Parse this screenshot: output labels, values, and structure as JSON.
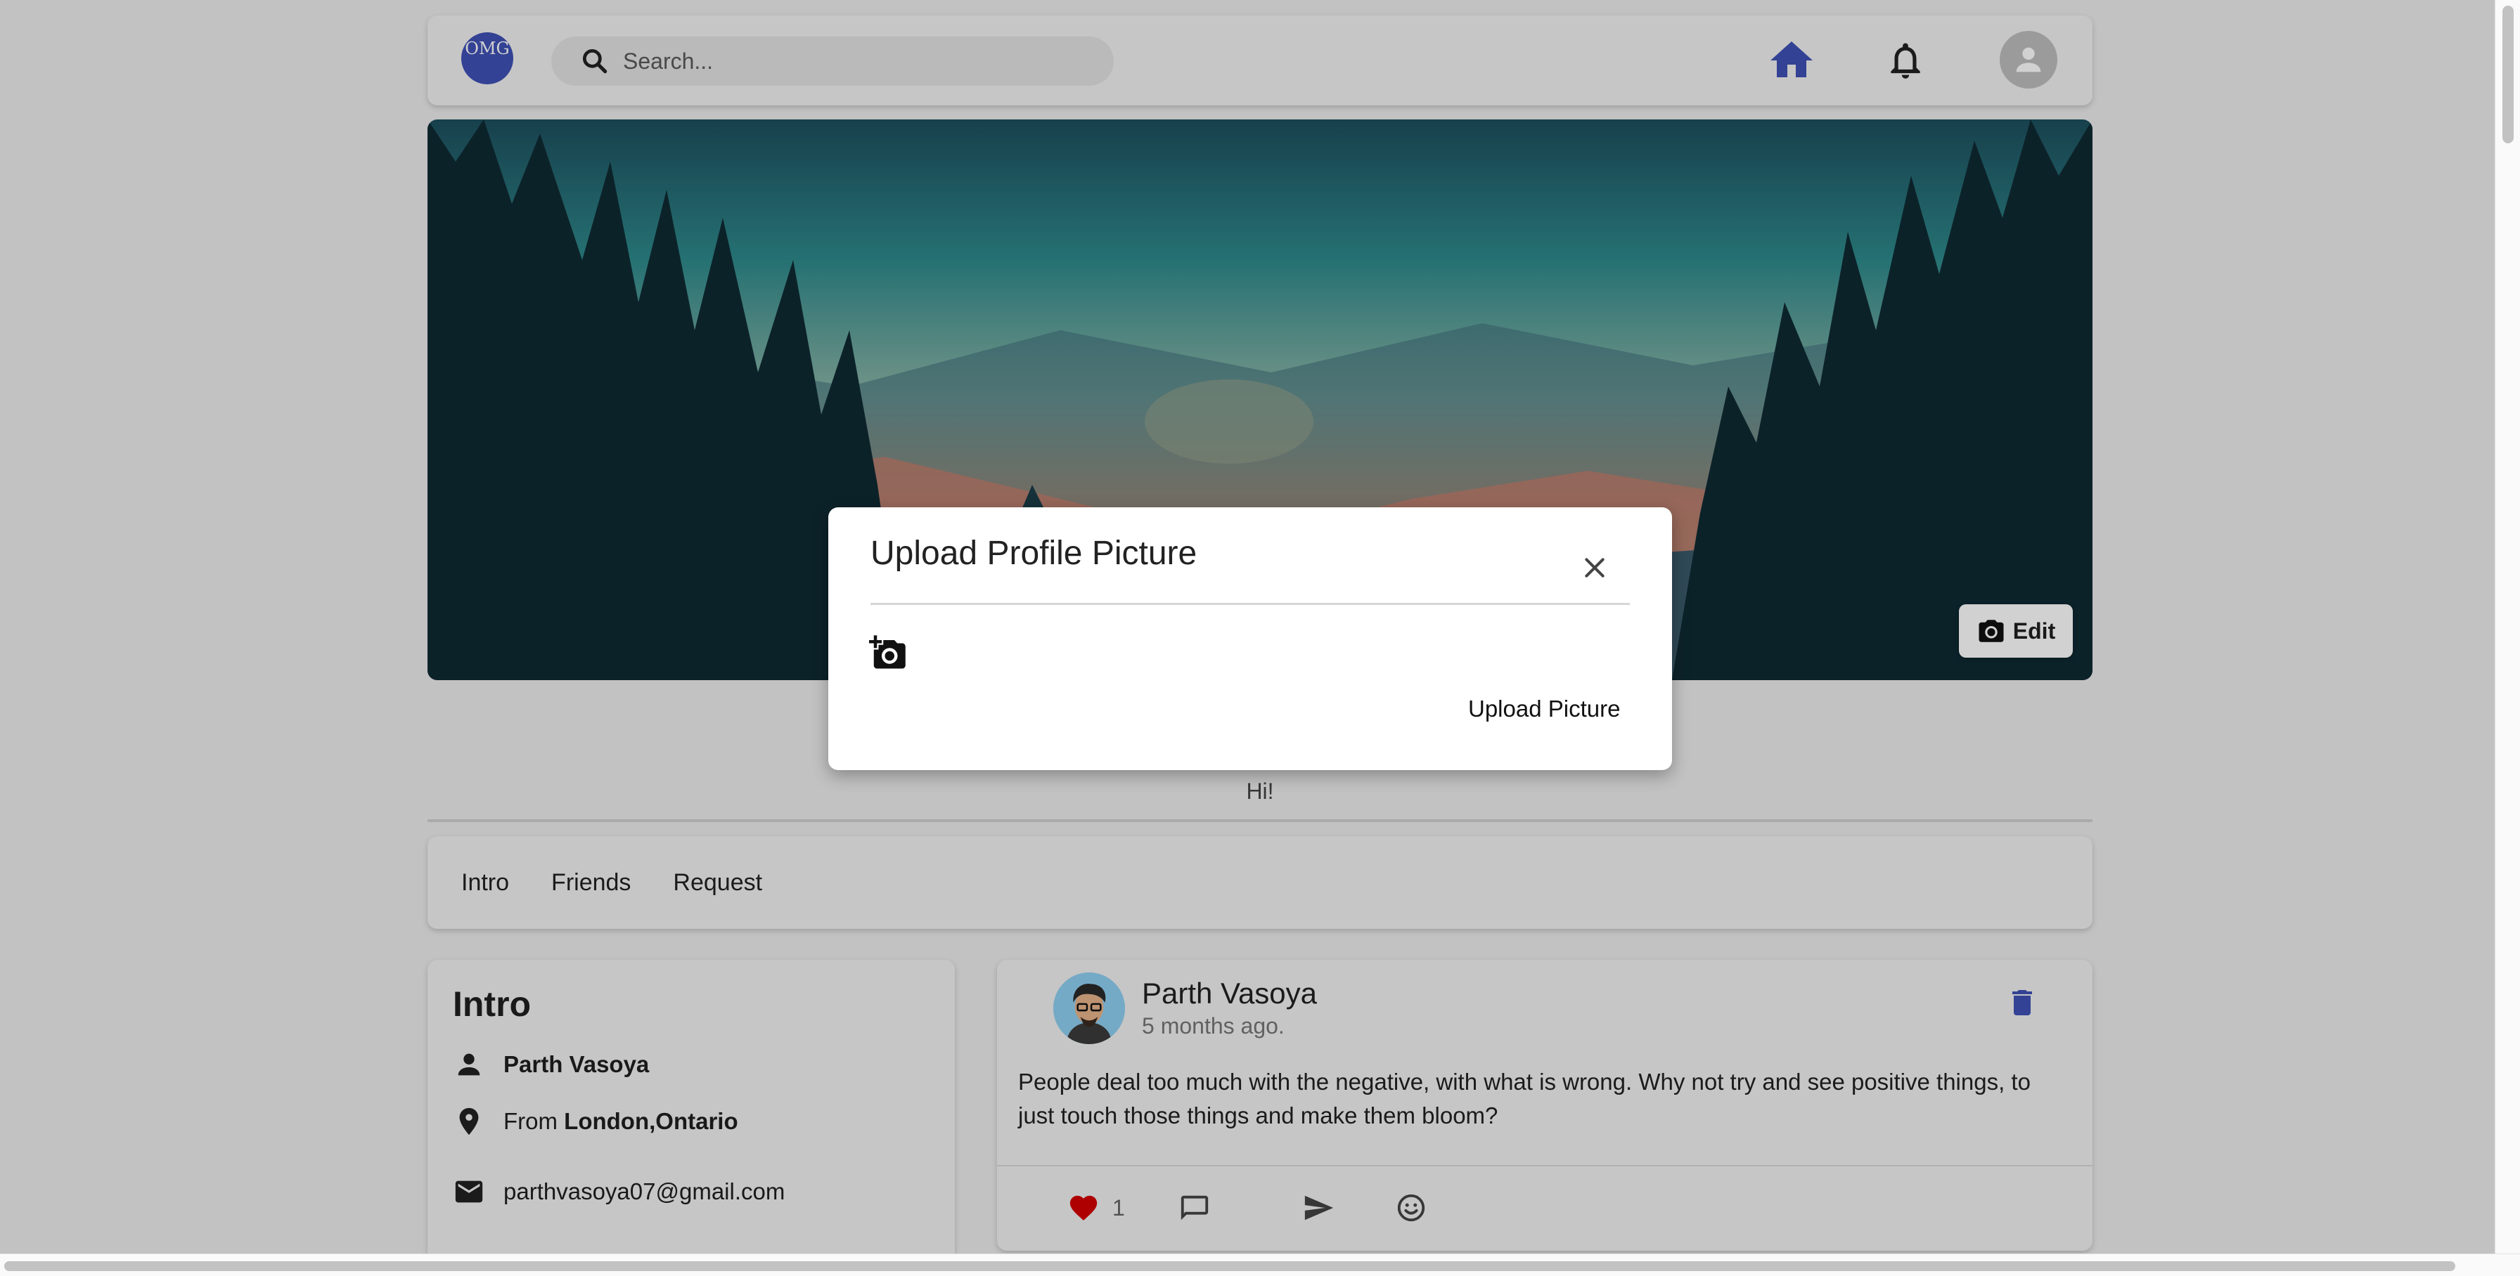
{
  "nav": {
    "logo_text": "OMG",
    "search_placeholder": "Search..."
  },
  "cover": {
    "edit_label": "Edit"
  },
  "profile": {
    "bio": "Hi!"
  },
  "tabs": [
    {
      "label": "Intro"
    },
    {
      "label": "Friends"
    },
    {
      "label": "Request"
    }
  ],
  "intro": {
    "title": "Intro",
    "name": "Parth Vasoya",
    "from_prefix": "From",
    "location": "London,Ontario",
    "email": "parthvasoya07@gmail.com"
  },
  "post": {
    "author": "Parth Vasoya",
    "time": "5 months ago.",
    "text": "People deal too much with the negative, with what is wrong. Why not try and see positive things, to just touch those things and make them bloom?",
    "like_count": "1"
  },
  "modal": {
    "title": "Upload Profile Picture",
    "upload_label": "Upload Picture"
  },
  "colors": {
    "accent": "#3f51b5",
    "like": "#d50000",
    "card_bg": "#f2f2f2",
    "page_bg": "#ededed"
  }
}
